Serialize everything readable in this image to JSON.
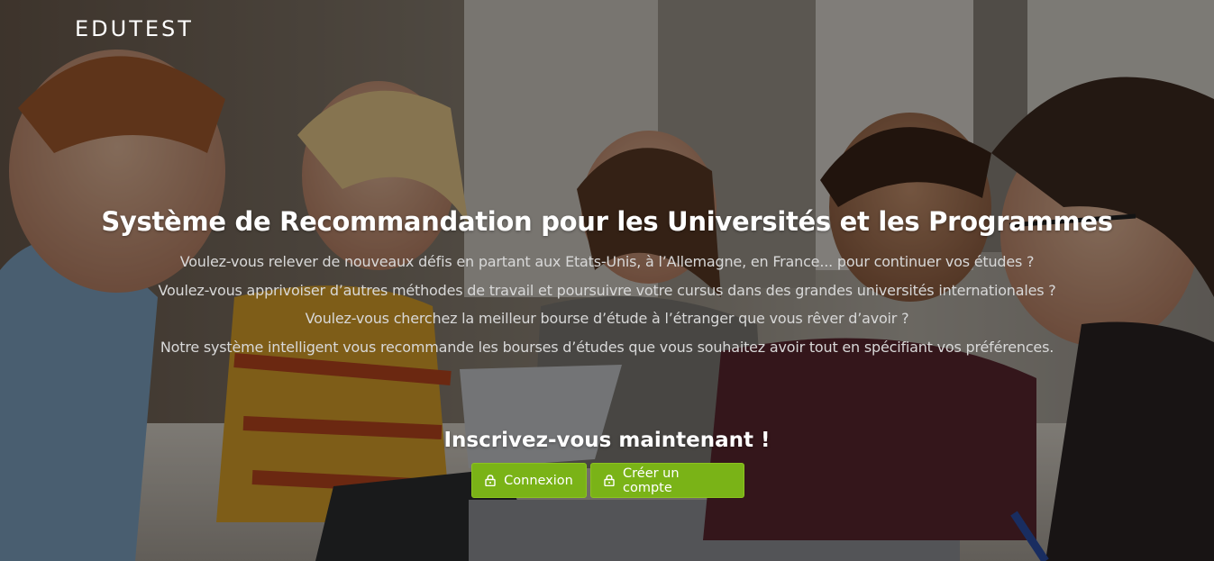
{
  "brand": {
    "name": "EDUTEST"
  },
  "hero": {
    "title": "Système de Recommandation pour les Universités et les Programmes",
    "lines": [
      "Voulez-vous relever de nouveaux défis en partant aux Etats-Unis, à l’Allemagne, en France... pour continuer vos études ?",
      "Voulez-vous apprivoiser d’autres méthodes de travail et poursuivre votre cursus dans des grandes universités internationales ?",
      "Voulez-vous cherchez la meilleur bourse d’étude à l’étranger que vous rêver d’avoir ?",
      "Notre système intelligent vous recommande les bourses d’études que vous souhaitez avoir tout en spécifiant vos préférences."
    ]
  },
  "cta": {
    "title": "Inscrivez-vous maintenant !",
    "login_label": "Connexion",
    "signup_label": "Créer un compte",
    "login_icon": "lock-icon",
    "signup_icon": "lock-icon"
  },
  "colors": {
    "button_green": "#7ab317",
    "overlay": "rgba(0,0,0,0.42)",
    "text": "#ffffff"
  }
}
